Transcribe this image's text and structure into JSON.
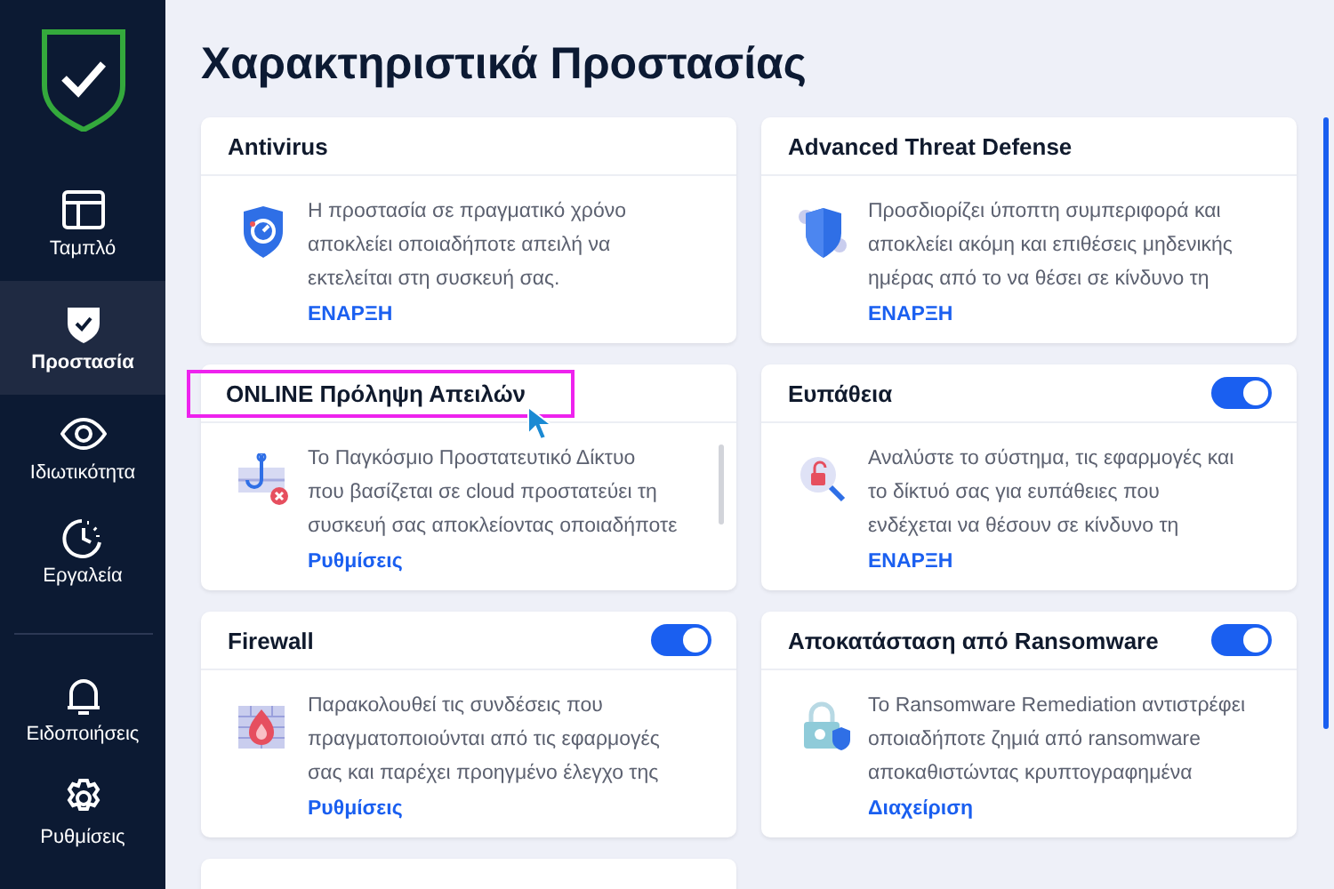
{
  "sidebar": {
    "items": [
      {
        "label": "Ταμπλό",
        "selected": false
      },
      {
        "label": "Προστασία",
        "selected": true
      },
      {
        "label": "Ιδιωτικότητα",
        "selected": false
      },
      {
        "label": "Εργαλεία",
        "selected": false
      }
    ],
    "bottom_items": [
      {
        "label": "Ειδοποιήσεις",
        "selected": false
      },
      {
        "label": "Ρυθμίσεις",
        "selected": false
      }
    ]
  },
  "page_title": "Χαρακτηριστικά Προστασίας",
  "cards": [
    {
      "title": "Antivirus",
      "highlighted": false,
      "description": "Η προστασία σε πραγματικό χρόνο\nαποκλείει οποιαδήποτε απειλή να\nεκτελείται στη συσκευή σας.",
      "action": "ΕΝΑΡΞΗ"
    },
    {
      "title": "Advanced Threat Defense",
      "highlighted": false,
      "description": "Προσδιορίζει ύποπτη συμπεριφορά και\nαποκλείει ακόμη και επιθέσεις μηδενικής\nημέρας από το να θέσει σε κίνδυνο τη",
      "action": "ΕΝΑΡΞΗ"
    },
    {
      "title": "ONLINE Πρόληψη Απειλών",
      "highlighted": true,
      "description": "Το Παγκόσμιο Προστατευτικό Δίκτυο\nπου βασίζεται σε cloud προστατεύει τη\nσυσκευή σας αποκλείοντας οποιαδήποτε",
      "action": "Ρυθμίσεις"
    },
    {
      "title": "Ευπάθεια",
      "highlighted": false,
      "on": true,
      "description": "Αναλύστε το σύστημα, τις εφαρμογές και\nτο δίκτυό σας για ευπάθειες που\nενδέχεται να θέσουν σε κίνδυνο τη",
      "action": "ΕΝΑΡΞΗ"
    },
    {
      "title": "Firewall",
      "highlighted": false,
      "on": true,
      "description": "Παρακολουθεί τις συνδέσεις που\nπραγματοποιούνται από τις εφαρμογές\nσας και παρέχει προηγμένο έλεγχο της",
      "action": "Ρυθμίσεις"
    },
    {
      "title": "Αποκατάσταση από Ransomware",
      "highlighted": false,
      "on": true,
      "description": "Το Ransomware Remediation αντιστρέφει\nοποιαδήποτε ζημιά από ransomware\nαποκαθιστώντας κρυπτογραφημένα",
      "action": "Διαχείριση"
    }
  ]
}
